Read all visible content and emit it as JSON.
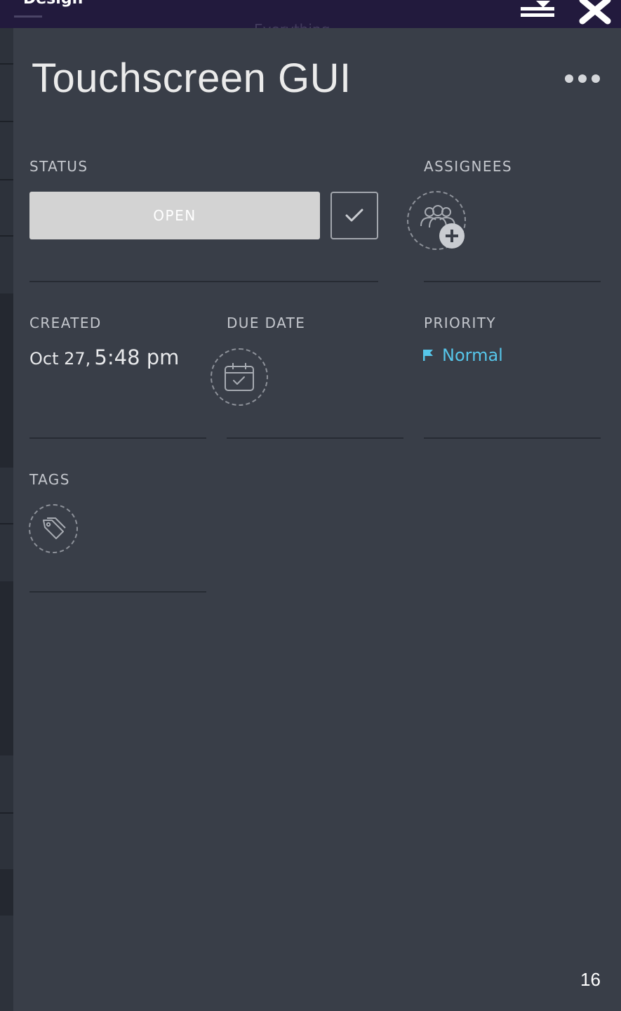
{
  "app": {
    "title": "Design",
    "background_tab_text": "Everything"
  },
  "task": {
    "title": "Touchscreen GUI"
  },
  "status": {
    "label": "STATUS",
    "value": "OPEN"
  },
  "assignees": {
    "label": "ASSIGNEES"
  },
  "created": {
    "label": "CREATED",
    "date": "Oct 27,",
    "time": "5:48 pm"
  },
  "due_date": {
    "label": "DUE DATE"
  },
  "priority": {
    "label": "PRIORITY",
    "value": "Normal"
  },
  "tags": {
    "label": "TAGS"
  },
  "slide": {
    "page_number": "16"
  },
  "icons": {
    "minimize": "minimize-icon",
    "close": "close-icon",
    "more": "more-icon",
    "check": "check-icon",
    "add_assignee": "add-user-group-icon",
    "calendar": "calendar-check-icon",
    "flag": "flag-icon",
    "tag": "tag-icon"
  },
  "colors": {
    "topbar": "#221a3d",
    "panel": "#393e48",
    "status_button": "#d3d3d3",
    "priority_normal": "#56c6ea"
  }
}
